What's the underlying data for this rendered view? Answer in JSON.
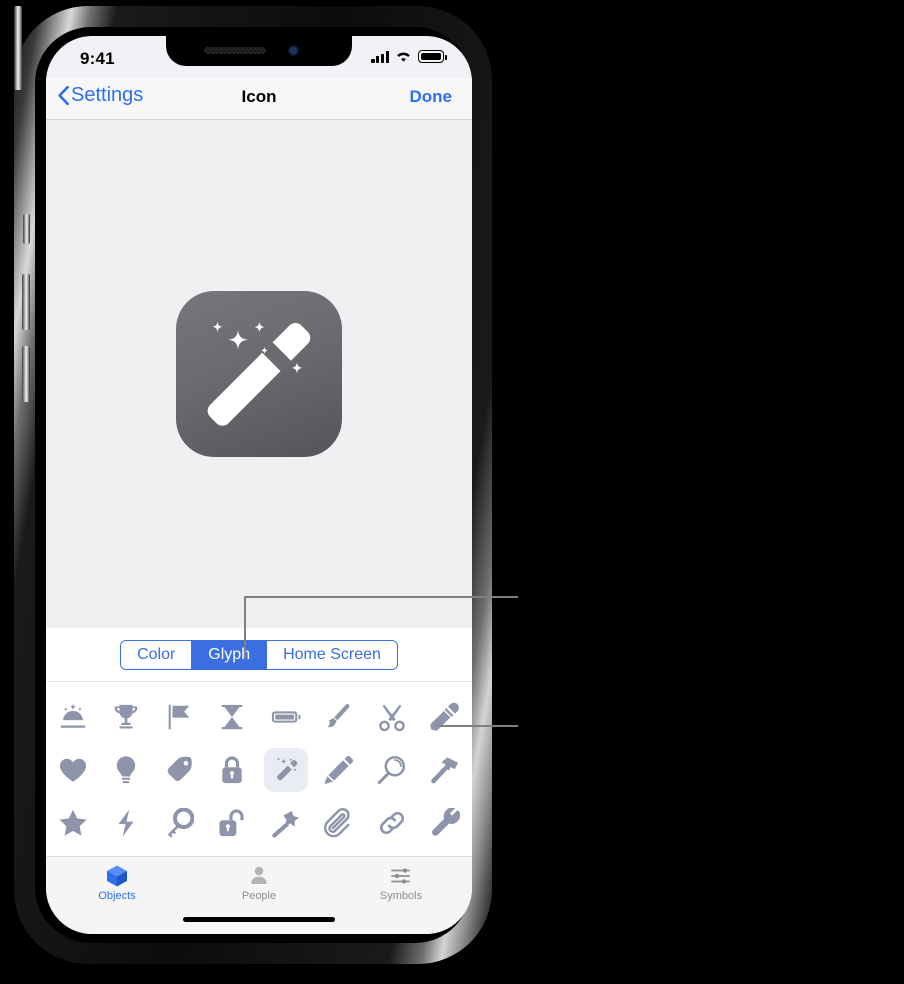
{
  "status_bar": {
    "time": "9:41",
    "signal_icon": "cellular-bars-icon",
    "wifi_icon": "wifi-icon",
    "battery_icon": "battery-full-icon"
  },
  "nav_bar": {
    "back_label": "Settings",
    "back_icon": "chevron-left-icon",
    "title": "Icon",
    "done_label": "Done"
  },
  "preview": {
    "icon_name": "magic-wand-app-icon",
    "bg_color": "#eef0f2",
    "icon_color_start": "#76767b",
    "icon_color_end": "#545459",
    "glyph_color": "#ffffff"
  },
  "segmented_control": {
    "accent": "#3b6fe0",
    "selected": "Glyph",
    "options": [
      {
        "label": "Color",
        "selected": false
      },
      {
        "label": "Glyph",
        "selected": true
      },
      {
        "label": "Home Screen",
        "selected": false
      }
    ]
  },
  "glyph_grid": {
    "glyph_color": "#8e95ab",
    "selected_bg": "#e9ecf2",
    "selected_glyph": "magic-wand",
    "rows": [
      [
        {
          "name": "sparkles-dome",
          "selected": false
        },
        {
          "name": "trophy",
          "selected": false
        },
        {
          "name": "flag",
          "selected": false
        },
        {
          "name": "hourglass",
          "selected": false
        },
        {
          "name": "battery",
          "selected": false
        },
        {
          "name": "paintbrush",
          "selected": false
        },
        {
          "name": "scissors",
          "selected": false
        },
        {
          "name": "eyedropper",
          "selected": false
        }
      ],
      [
        {
          "name": "heart",
          "selected": false
        },
        {
          "name": "lightbulb",
          "selected": false
        },
        {
          "name": "tag",
          "selected": false
        },
        {
          "name": "lock",
          "selected": false
        },
        {
          "name": "magic-wand",
          "selected": true
        },
        {
          "name": "pencil",
          "selected": false
        },
        {
          "name": "magnifier",
          "selected": false
        },
        {
          "name": "hammer",
          "selected": false
        }
      ],
      [
        {
          "name": "star",
          "selected": false
        },
        {
          "name": "bolt",
          "selected": false
        },
        {
          "name": "key",
          "selected": false
        },
        {
          "name": "unlock",
          "selected": false
        },
        {
          "name": "wand-star",
          "selected": false
        },
        {
          "name": "paperclip",
          "selected": false
        },
        {
          "name": "link",
          "selected": false
        },
        {
          "name": "wrench",
          "selected": false
        }
      ]
    ]
  },
  "tab_bar": {
    "active_color": "#2f6fed",
    "inactive_color": "#8e8e93",
    "tabs": [
      {
        "label": "Objects",
        "icon": "cube-icon",
        "selected": true
      },
      {
        "label": "People",
        "icon": "person-icon",
        "selected": false
      },
      {
        "label": "Symbols",
        "icon": "sliders-icon",
        "selected": false
      }
    ]
  },
  "callouts": {
    "line_color": "#808080",
    "items": [
      {
        "name": "callout-to-glyph-segment"
      },
      {
        "name": "callout-to-eyedropper-glyph"
      }
    ]
  }
}
